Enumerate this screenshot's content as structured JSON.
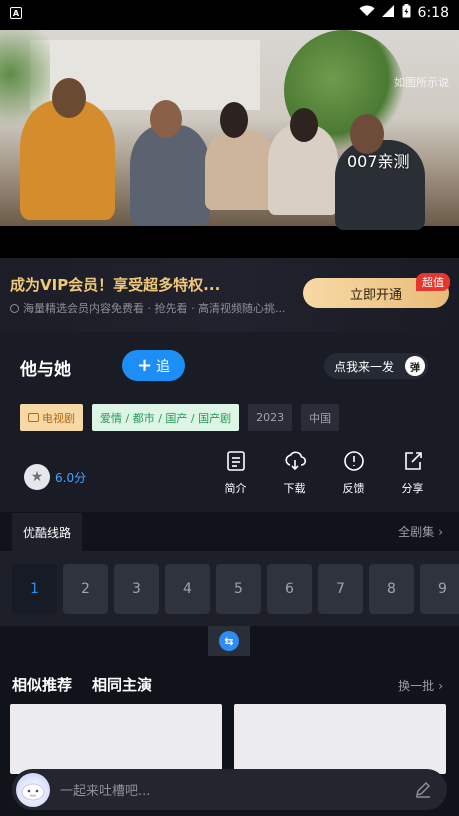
{
  "status_bar": {
    "app_glyph": "A",
    "time": "6:18",
    "icons": [
      "wifi-icon",
      "signal-icon",
      "battery-icon"
    ]
  },
  "video": {
    "watermark": "007亲测",
    "corner_text": "如图所示说"
  },
  "vip_banner": {
    "title": "成为VIP会员！享受超多特权...",
    "subtitle": "海量精选会员内容免费看 · 抢先看 · 高清视频随心挑...",
    "button_label": "立即开通",
    "badge": "超值"
  },
  "show": {
    "title": "他与她",
    "follow_label": "追",
    "bullet_label": "点我来一发",
    "bullet_toggle": "弹",
    "tags": {
      "type": "电视剧",
      "genre": "爱情 / 都市 / 国产 / 国产剧",
      "year": "2023",
      "region": "中国"
    },
    "rating": "6.0分",
    "actions": [
      {
        "label": "简介",
        "icon": "intro-icon"
      },
      {
        "label": "下载",
        "icon": "download-icon"
      },
      {
        "label": "反馈",
        "icon": "feedback-icon"
      },
      {
        "label": "分享",
        "icon": "share-icon"
      }
    ]
  },
  "episodes": {
    "route_label": "优酷线路",
    "all_label": "全剧集",
    "selected": "1",
    "items": [
      "1",
      "2",
      "3",
      "4",
      "5",
      "6",
      "7",
      "8",
      "9"
    ]
  },
  "recommend": {
    "tab_similar": "相似推荐",
    "tab_cast": "相同主演",
    "refresh_label": "换一批"
  },
  "comment": {
    "placeholder": "一起来吐槽吧..."
  },
  "colors": {
    "accent": "#1e8ef7",
    "vip_gold": "#f0c978",
    "badge_red": "#e8362f",
    "background": "#10131a"
  }
}
